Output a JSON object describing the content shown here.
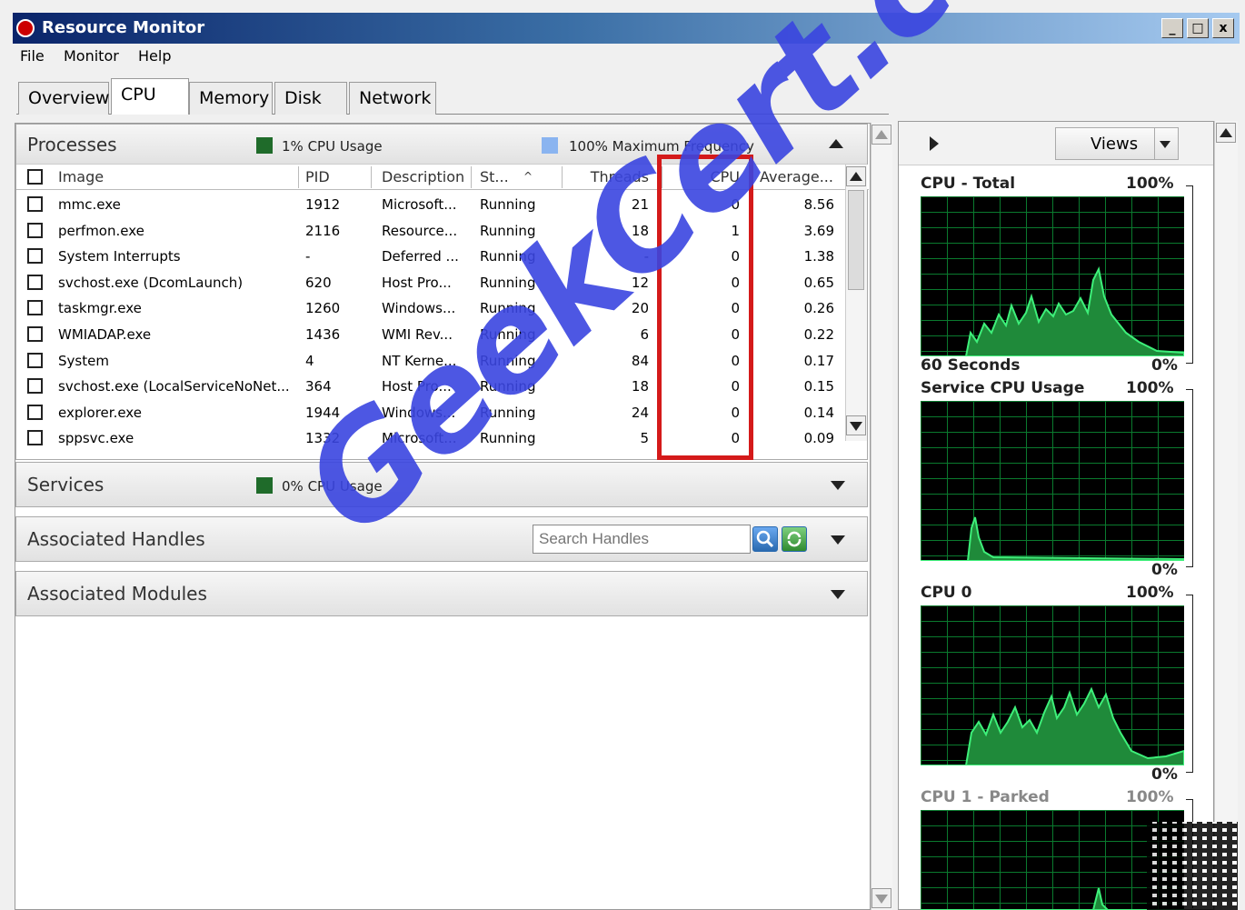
{
  "window": {
    "title": "Resource Monitor",
    "min": "_",
    "max": "□",
    "close": "x"
  },
  "menu": [
    "File",
    "Monitor",
    "Help"
  ],
  "tabs": [
    "Overview",
    "CPU",
    "Memory",
    "Disk",
    "Network"
  ],
  "processes": {
    "title": "Processes",
    "cpu_usage": "1% CPU Usage",
    "max_freq": "100% Maximum Frequency",
    "columns": [
      "Image",
      "PID",
      "Description",
      "St...",
      "Threads",
      "CPU",
      "Average..."
    ],
    "rows": [
      [
        "mmc.exe",
        "1912",
        "Microsoft...",
        "Running",
        "21",
        "0",
        "8.56"
      ],
      [
        "perfmon.exe",
        "2116",
        "Resource...",
        "Running",
        "18",
        "1",
        "3.69"
      ],
      [
        "System Interrupts",
        "-",
        "Deferred ...",
        "Running",
        "-",
        "0",
        "1.38"
      ],
      [
        "svchost.exe (DcomLaunch)",
        "620",
        "Host Pro...",
        "Running",
        "12",
        "0",
        "0.65"
      ],
      [
        "taskmgr.exe",
        "1260",
        "Windows...",
        "Running",
        "20",
        "0",
        "0.26"
      ],
      [
        "WMIADAP.exe",
        "1436",
        "WMI Rev...",
        "Running",
        "6",
        "0",
        "0.22"
      ],
      [
        "System",
        "4",
        "NT Kerne...",
        "Running",
        "84",
        "0",
        "0.17"
      ],
      [
        "svchost.exe (LocalServiceNoNet...",
        "364",
        "Host Pro...",
        "Running",
        "18",
        "0",
        "0.15"
      ],
      [
        "explorer.exe",
        "1944",
        "Windows...",
        "Running",
        "24",
        "0",
        "0.14"
      ],
      [
        "sppsvc.exe",
        "1332",
        "Microsoft...",
        "Running",
        "5",
        "0",
        "0.09"
      ]
    ]
  },
  "services": {
    "title": "Services",
    "cpu_usage": "0% CPU Usage"
  },
  "handles": {
    "title": "Associated Handles",
    "search_placeholder": "Search Handles"
  },
  "modules": {
    "title": "Associated Modules"
  },
  "right": {
    "views_label": "Views",
    "graphs": [
      {
        "name": "CPU - Total",
        "top_pct": "100%",
        "bottom_left": "60 Seconds",
        "bottom_pct": "0%"
      },
      {
        "name": "Service CPU Usage",
        "top_pct": "100%",
        "bottom_left": "",
        "bottom_pct": "0%"
      },
      {
        "name": "CPU 0",
        "top_pct": "100%",
        "bottom_left": "",
        "bottom_pct": "0%"
      },
      {
        "name": "CPU 1 - Parked",
        "top_pct": "100%",
        "bottom_left": "",
        "bottom_pct": ""
      }
    ]
  },
  "watermark": "GeekCert.com",
  "colors": {
    "graph_bg": "#000000",
    "graph_line": "#22c55e",
    "accent_red": "#d41a1a",
    "cpu_legend": "#1f6b2a",
    "freq_legend": "#8ab4f0"
  }
}
